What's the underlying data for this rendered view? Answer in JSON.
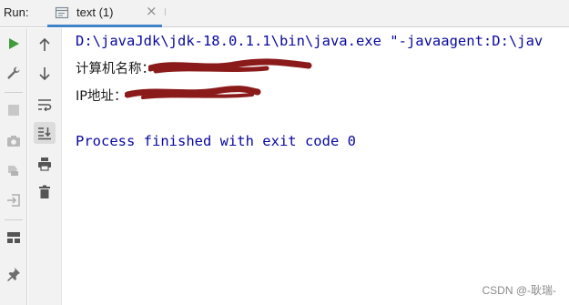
{
  "header": {
    "run_label": "Run:",
    "tab": {
      "title": "text (1)",
      "close_glyph": "×",
      "icon": "console-tab-icon"
    }
  },
  "console": {
    "lines": [
      "D:\\javaJdk\\jdk-18.0.1.1\\bin\\java.exe \"-javaagent:D:\\jav",
      "计算机名称：",
      "IP地址：",
      "Process finished with exit code 0"
    ],
    "redaction_color": "#8b1a1a"
  },
  "toolbar_icons": {
    "left": [
      "run-icon",
      "settings-wrench-icon",
      "stop-icon",
      "screenshot-camera-icon",
      "rerun-failed-icon",
      "login-icon",
      "layout-icon",
      "pin-icon"
    ],
    "right": [
      "up-arrow-icon",
      "down-arrow-icon",
      "soft-wrap-icon",
      "scroll-to-end-icon",
      "print-icon",
      "trash-icon"
    ]
  },
  "colors": {
    "output_blue": "#08089f",
    "run_green": "#3f9c3a",
    "tab_accent": "#4083c9"
  },
  "watermark": "CSDN @-耿瑞-"
}
